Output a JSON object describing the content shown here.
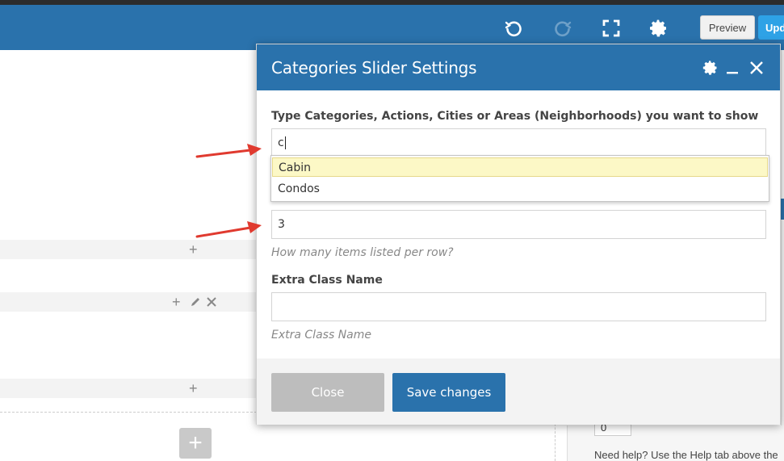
{
  "toolbar": {
    "preview_label": "Preview",
    "update_label": "Update"
  },
  "modal": {
    "title": "Categories Slider Settings",
    "field_categories": {
      "label": "Type Categories, Actions, Cities or Areas (Neighborhoods) you want to show",
      "value": "c"
    },
    "autocomplete": [
      "Cabin",
      "Condos"
    ],
    "field_per_row": {
      "value": "3",
      "hint": "How many items listed per row?"
    },
    "field_extra_class": {
      "label": "Extra Class Name",
      "value": "",
      "hint": "Extra Class Name"
    },
    "close_label": "Close",
    "save_label": "Save changes"
  },
  "right_panel": {
    "number_value": "0",
    "help_text": "Need help? Use the Help tab above the"
  },
  "colors": {
    "toolbar": "#2a72ac",
    "accent_update": "#2ea2e6",
    "arrow": "#e03a2f",
    "highlight": "#fcf8c6"
  }
}
